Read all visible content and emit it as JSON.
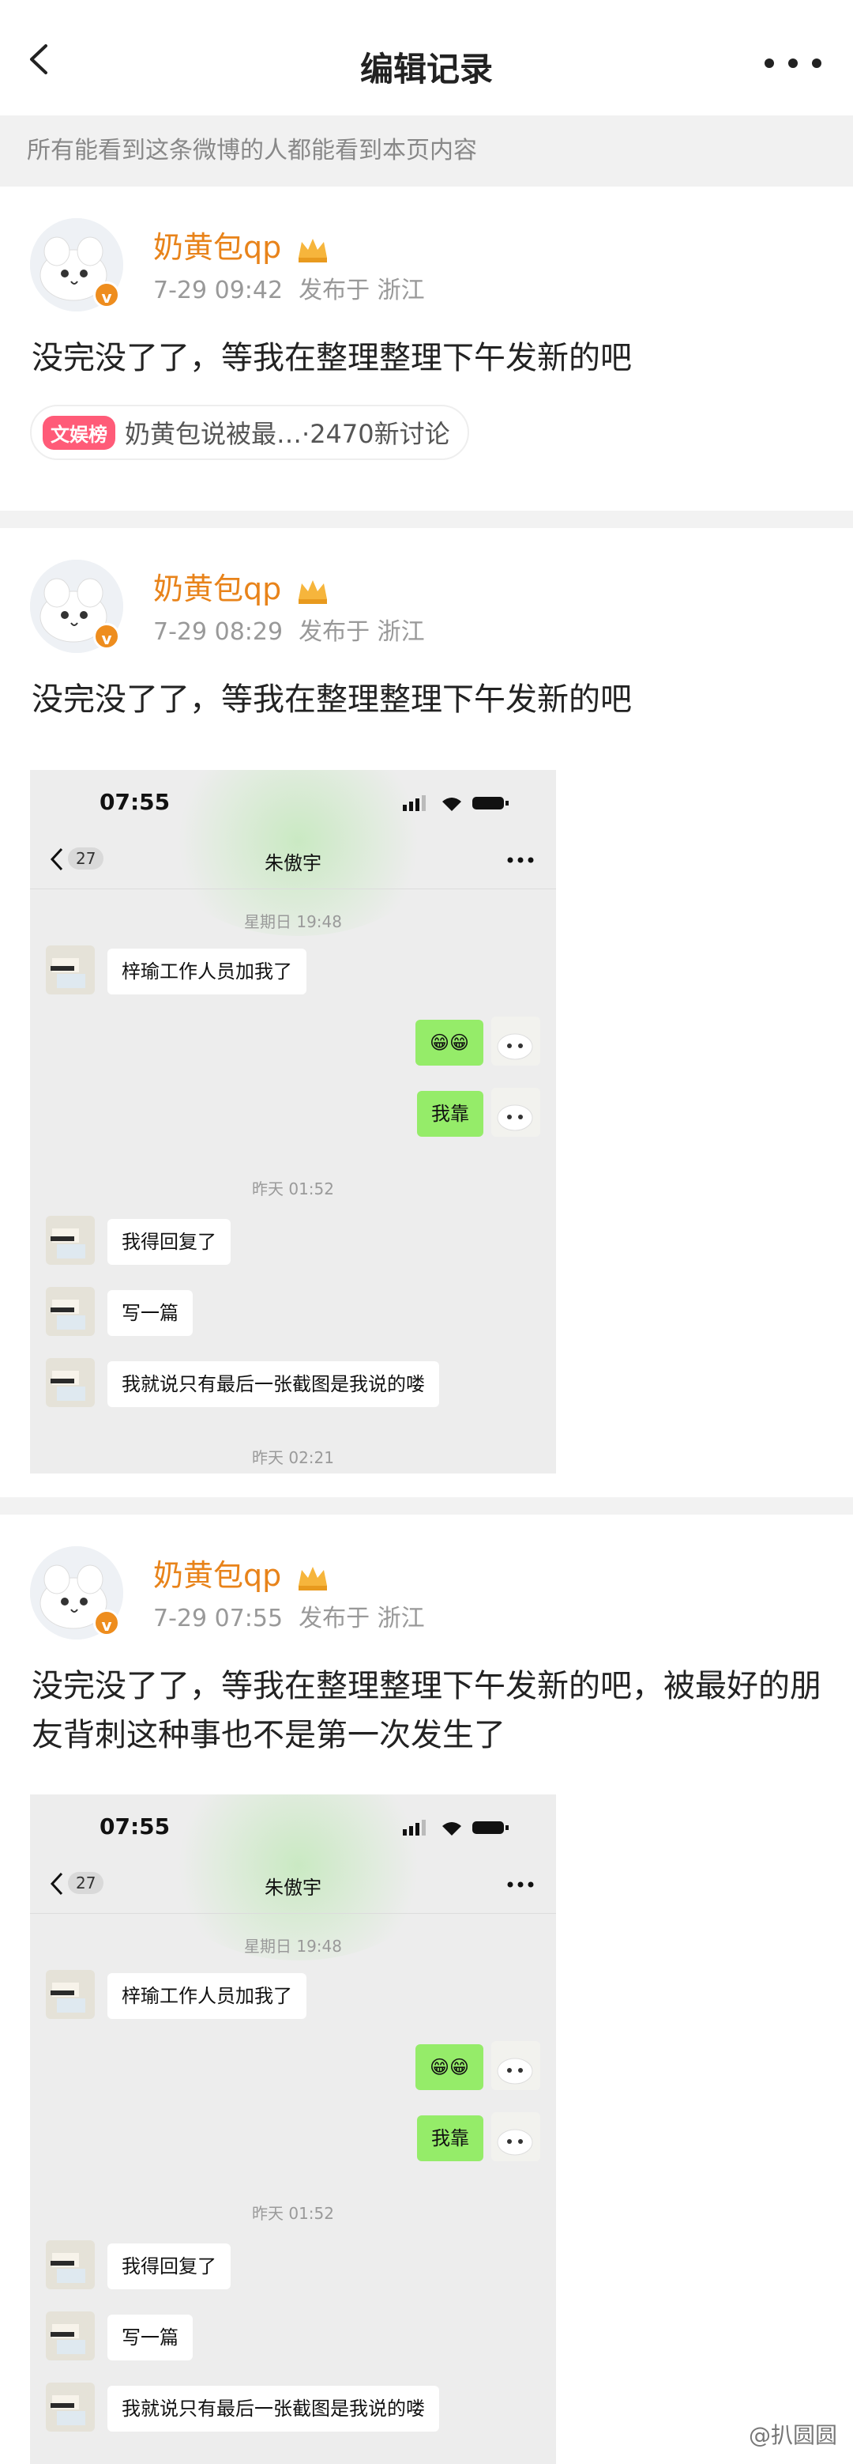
{
  "header": {
    "title": "编辑记录"
  },
  "notice": "所有能看到这条微博的人都能看到本页内容",
  "posts": [
    {
      "username": "奶黄包qp",
      "date": "7-29 09:42",
      "location": "发布于 浙江",
      "text": "没完没了了，等我在整理整理下午发新的吧",
      "tag": {
        "badge": "文娱榜",
        "text": "奶黄包说被最…",
        "count": "·2470新讨论"
      }
    },
    {
      "username": "奶黄包qp",
      "date": "7-29 08:29",
      "location": "发布于 浙江",
      "text": "没完没了了，等我在整理整理下午发新的吧"
    },
    {
      "username": "奶黄包qp",
      "date": "7-29 07:55",
      "location": "发布于 浙江",
      "text": "没完没了了，等我在整理整理下午发新的吧，被最好的朋友背刺这种事也不是第一次发生了"
    }
  ],
  "chat": {
    "status_time": "07:55",
    "back_count": "27",
    "contact": "朱傲宇",
    "ts1": "星期日 19:48",
    "msg1": "梓瑜工作人员加我了",
    "msg2": "😁😁",
    "msg3": "我靠",
    "ts2": "昨天 01:52",
    "msg4": "我得回复了",
    "msg5": "写一篇",
    "msg6": "我就说只有最后一张截图是我说的喽",
    "ts3": "昨天 02:21"
  },
  "watermark": "@扒圆圆",
  "colors": {
    "username": "#e8831a",
    "wechat_green": "#95ec69",
    "tag_badge": "#ff5b78"
  }
}
